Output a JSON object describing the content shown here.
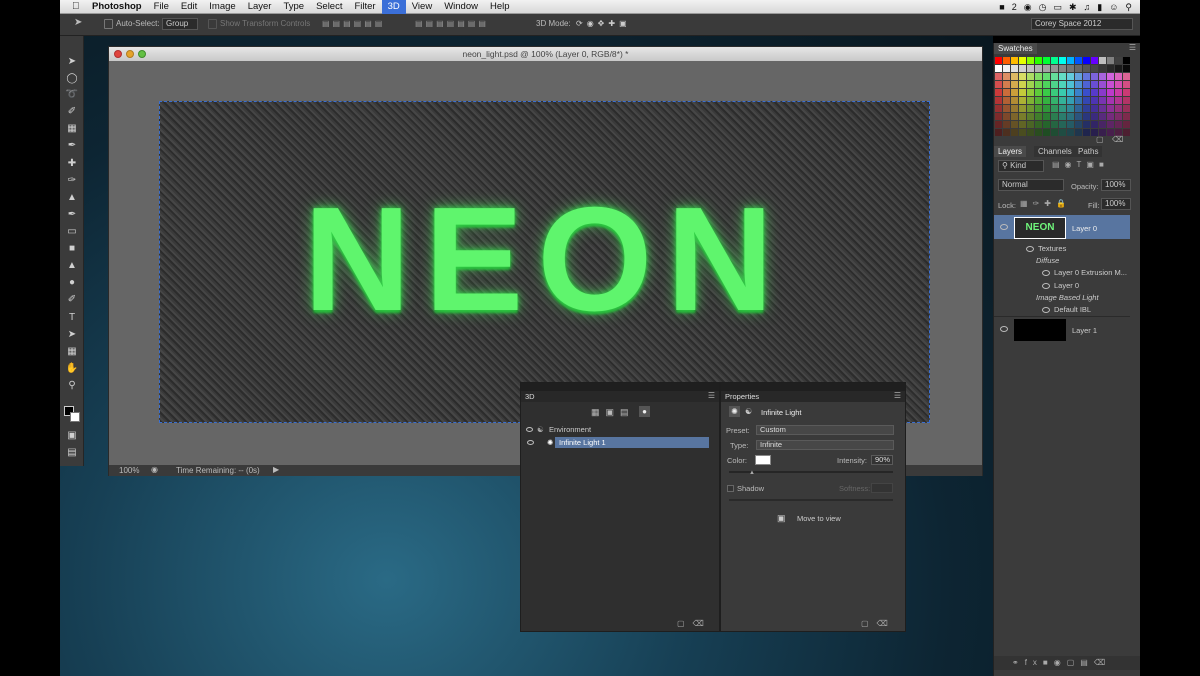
{
  "menubar": {
    "app": "Photoshop",
    "items": [
      "File",
      "Edit",
      "Image",
      "Layer",
      "Type",
      "Select",
      "Filter",
      "3D",
      "View",
      "Window",
      "Help"
    ],
    "active": "3D",
    "status_num": "2"
  },
  "options": {
    "auto_select": "Auto-Select:",
    "group": "Group",
    "show_transform": "Show Transform Controls",
    "mode_3d": "3D Mode:",
    "workspace": "Corey Space 2012"
  },
  "document": {
    "title": "neon_light.psd @ 100% (Layer 0, RGB/8*) *",
    "text": "NEON",
    "zoom": "100%",
    "status": "Time Remaining: -- (0s)"
  },
  "swatches": {
    "tab": "Swatches"
  },
  "layers": {
    "tabs": [
      "Layers",
      "Channels",
      "Paths"
    ],
    "kind": "Kind",
    "blend": "Normal",
    "opacity_label": "Opacity:",
    "opacity": "100%",
    "lock_label": "Lock:",
    "fill_label": "Fill:",
    "fill": "100%",
    "layer0_thumb": "NEON",
    "layer0": "Layer 0",
    "textures": "Textures",
    "diffuse": "Diffuse",
    "extrusion": "Layer 0 Extrusion M...",
    "layer0b": "Layer 0",
    "ibl": "Image Based Light",
    "default_ibl": "Default IBL",
    "layer1": "Layer 1"
  },
  "panel3d": {
    "title": "3D",
    "environment": "Environment",
    "light": "Infinite Light 1"
  },
  "properties": {
    "title": "Properties",
    "light_name": "Infinite Light",
    "preset_label": "Preset:",
    "preset": "Custom",
    "type_label": "Type:",
    "type": "Infinite",
    "color_label": "Color:",
    "intensity_label": "Intensity:",
    "intensity": "90%",
    "shadow": "Shadow",
    "softness": "Softness:",
    "move": "Move to view"
  }
}
